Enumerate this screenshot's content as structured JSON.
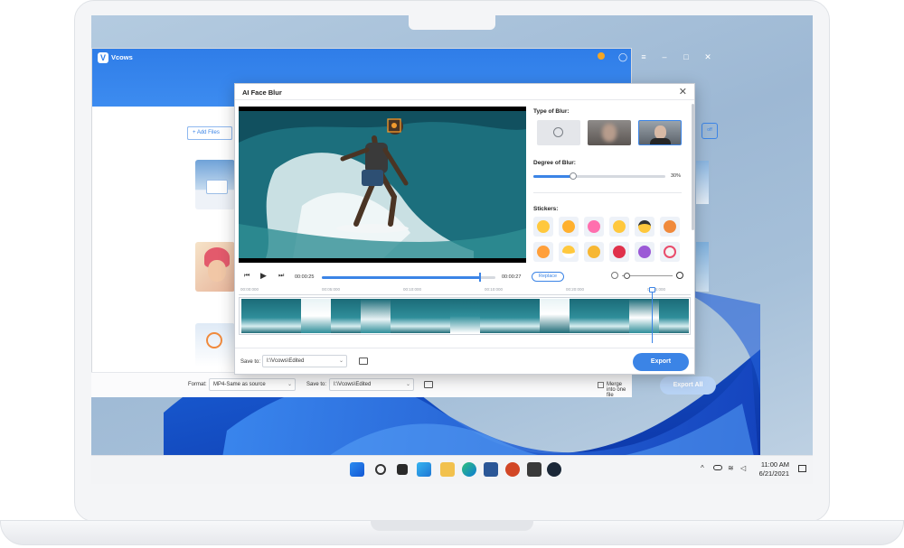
{
  "app": {
    "name": "Vcows"
  },
  "toolbar": {
    "add_files": "+ Add Files"
  },
  "dialog": {
    "title": "AI Face Blur",
    "type_of_blur_label": "Type of Blur:",
    "degree_label": "Degree of Blur:",
    "degree_value": "30%",
    "degree_fraction": 0.3,
    "stickers_label": "Stickers:",
    "current_time": "00:00:25",
    "total_time": "00:00:27",
    "progress_fraction": 0.91,
    "replace_label": "Replace",
    "timeline_ticks": [
      "00:00:000",
      "00:05:000",
      "00:10:000",
      "00:10:000",
      "00:20:000",
      "00:25:000"
    ],
    "save_to_label": "Save to:",
    "save_to_path": "I:\\Vcows\\Edited",
    "export_label": "Export"
  },
  "bottom": {
    "format_label": "Format:",
    "format_value": "MP4-Same as source",
    "save_to_label": "Save to:",
    "save_to_path": "I:\\Vcows\\Edited",
    "merge_label": "Merge into one file",
    "export_all_label": "Export All"
  },
  "tray": {
    "time": "11:00 AM",
    "date": "6/21/2021"
  },
  "colors": {
    "accent": "#3b84e6",
    "titlebar": "#2f7de8"
  }
}
